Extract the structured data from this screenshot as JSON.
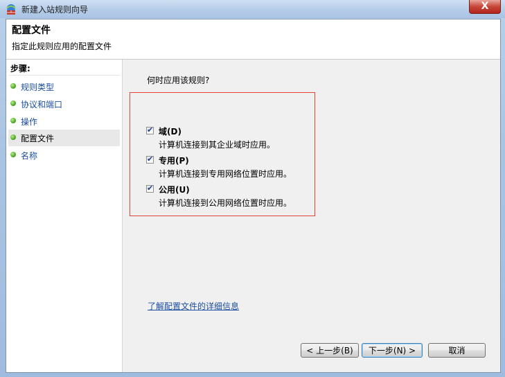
{
  "window": {
    "title": "新建入站规则向导",
    "close_label": "X"
  },
  "header": {
    "title": "配置文件",
    "subtitle": "指定此规则应用的配置文件"
  },
  "sidebar": {
    "title": "步骤:",
    "items": [
      {
        "label": "规则类型"
      },
      {
        "label": "协议和端口"
      },
      {
        "label": "操作"
      },
      {
        "label": "配置文件"
      },
      {
        "label": "名称"
      }
    ]
  },
  "main": {
    "question": "何时应用该规则?",
    "options": [
      {
        "label": "域(D)",
        "desc": "计算机连接到其企业域时应用。",
        "checked": true
      },
      {
        "label": "专用(P)",
        "desc": "计算机连接到专用网络位置时应用。",
        "checked": true
      },
      {
        "label": "公用(U)",
        "desc": "计算机连接到公用网络位置时应用。",
        "checked": true
      }
    ],
    "learn_link": "了解配置文件的详细信息"
  },
  "buttons": {
    "back": "< 上一步(B)",
    "next": "下一步(N) >",
    "cancel": "取消"
  }
}
